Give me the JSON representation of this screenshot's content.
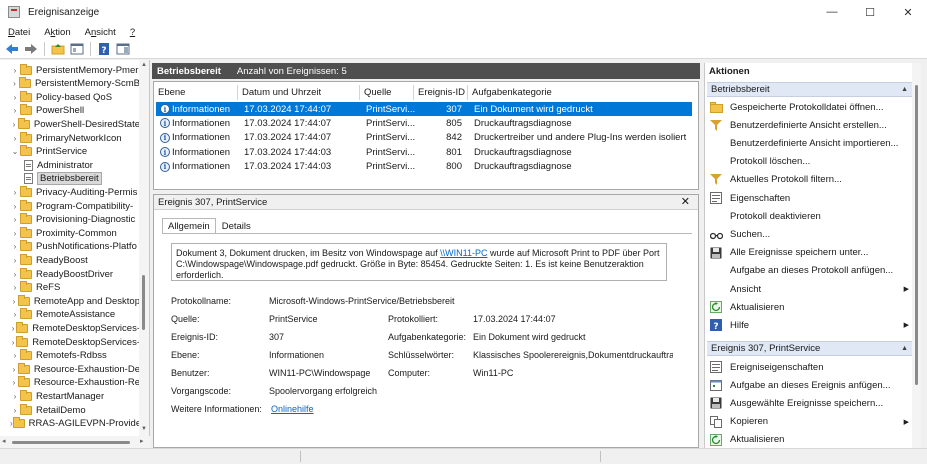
{
  "window": {
    "title": "Ereignisanzeige",
    "controls": [
      "—",
      "☐",
      "✕"
    ]
  },
  "menu": [
    {
      "label": "Datei",
      "accel": "D",
      "rest": "atei"
    },
    {
      "label": "Aktion",
      "accel": "k",
      "pre": "A",
      "rest": "tion"
    },
    {
      "label": "Ansicht",
      "accel": "n",
      "pre": "A",
      "rest": "sicht"
    },
    {
      "label": "?",
      "accel": "?",
      "rest": ""
    }
  ],
  "toolbar": [
    "back-arrow-icon",
    "forward-arrow-icon",
    "folder-up-icon",
    "console-tree-icon",
    "help-icon",
    "action-pane-icon"
  ],
  "tree": {
    "items": [
      {
        "label": "PersistentMemory-Pmer",
        "level": 1,
        "type": "folder",
        "expander": "›"
      },
      {
        "label": "PersistentMemory-ScmB",
        "level": 1,
        "type": "folder",
        "expander": "›"
      },
      {
        "label": "Policy-based QoS",
        "level": 1,
        "type": "folder",
        "expander": "›"
      },
      {
        "label": "PowerShell",
        "level": 1,
        "type": "folder",
        "expander": "›"
      },
      {
        "label": "PowerShell-DesiredState",
        "level": 1,
        "type": "folder",
        "expander": "›"
      },
      {
        "label": "PrimaryNetworkIcon",
        "level": 1,
        "type": "folder",
        "expander": "›"
      },
      {
        "label": "PrintService",
        "level": 1,
        "type": "folder",
        "expander": "⌄"
      },
      {
        "label": "Administrator",
        "level": 2,
        "type": "doc",
        "expander": ""
      },
      {
        "label": "Betriebsbereit",
        "level": 2,
        "type": "doc",
        "expander": "",
        "selected": true
      },
      {
        "label": "Privacy-Auditing-Permis",
        "level": 1,
        "type": "folder",
        "expander": "›"
      },
      {
        "label": "Program-Compatibility-",
        "level": 1,
        "type": "folder",
        "expander": "›"
      },
      {
        "label": "Provisioning-Diagnostic",
        "level": 1,
        "type": "folder",
        "expander": "›"
      },
      {
        "label": "Proximity-Common",
        "level": 1,
        "type": "folder",
        "expander": "›"
      },
      {
        "label": "PushNotifications-Platfo",
        "level": 1,
        "type": "folder",
        "expander": "›"
      },
      {
        "label": "ReadyBoost",
        "level": 1,
        "type": "folder",
        "expander": "›"
      },
      {
        "label": "ReadyBoostDriver",
        "level": 1,
        "type": "folder",
        "expander": "›"
      },
      {
        "label": "ReFS",
        "level": 1,
        "type": "folder",
        "expander": "›"
      },
      {
        "label": "RemoteApp and Desktop",
        "level": 1,
        "type": "folder",
        "expander": "›"
      },
      {
        "label": "RemoteAssistance",
        "level": 1,
        "type": "folder",
        "expander": "›"
      },
      {
        "label": "RemoteDesktopServices-",
        "level": 1,
        "type": "folder",
        "expander": "›"
      },
      {
        "label": "RemoteDesktopServices-",
        "level": 1,
        "type": "folder",
        "expander": "›"
      },
      {
        "label": "Remotefs-Rdbss",
        "level": 1,
        "type": "folder",
        "expander": "›"
      },
      {
        "label": "Resource-Exhaustion-De",
        "level": 1,
        "type": "folder",
        "expander": "›"
      },
      {
        "label": "Resource-Exhaustion-Re",
        "level": 1,
        "type": "folder",
        "expander": "›"
      },
      {
        "label": "RestartManager",
        "level": 1,
        "type": "folder",
        "expander": "›"
      },
      {
        "label": "RetailDemo",
        "level": 1,
        "type": "folder",
        "expander": "›"
      },
      {
        "label": "RRAS-AGILEVPN-Provide",
        "level": 1,
        "type": "folder",
        "expander": "›"
      }
    ]
  },
  "center": {
    "log_name": "Betriebsbereit",
    "count_text": "Anzahl von Ereignissen: 5",
    "columns": [
      "Ebene",
      "Datum und Uhrzeit",
      "Quelle",
      "Ereignis-ID",
      "Aufgabenkategorie"
    ],
    "rows": [
      {
        "level": "Informationen",
        "date": "17.03.2024 17:44:07",
        "source": "PrintServi...",
        "id": "307",
        "category": "Ein Dokument wird gedruckt",
        "selected": true
      },
      {
        "level": "Informationen",
        "date": "17.03.2024 17:44:07",
        "source": "PrintServi...",
        "id": "805",
        "category": "Druckauftragsdiagnose"
      },
      {
        "level": "Informationen",
        "date": "17.03.2024 17:44:07",
        "source": "PrintServi...",
        "id": "842",
        "category": "Druckertreiber und andere Plug-Ins werden isoliert"
      },
      {
        "level": "Informationen",
        "date": "17.03.2024 17:44:03",
        "source": "PrintServi...",
        "id": "801",
        "category": "Druckauftragsdiagnose"
      },
      {
        "level": "Informationen",
        "date": "17.03.2024 17:44:03",
        "source": "PrintServi...",
        "id": "800",
        "category": "Druckauftragsdiagnose"
      }
    ]
  },
  "detail": {
    "title": "Ereignis 307, PrintService",
    "close": "✕",
    "tabs": [
      "Allgemein",
      "Details"
    ],
    "description": {
      "pre": "Dokument 3, Dokument drucken, im Besitz von Windowspage auf ",
      "link": "\\\\WIN11-PC",
      "post": " wurde auf Microsoft Print to PDF über Port C:\\Windowspage\\Windowspage.pdf gedruckt. Größe in Byte: 85454. Gedruckte Seiten: 1. Es ist keine Benutzeraktion erforderlich."
    },
    "fields": {
      "protokollname_label": "Protokollname:",
      "protokollname": "Microsoft-Windows-PrintService/Betriebsbereit",
      "quelle_label": "Quelle:",
      "quelle": "PrintService",
      "protokolliert_label": "Protokolliert:",
      "protokolliert": "17.03.2024 17:44:07",
      "id_label": "Ereignis-ID:",
      "id": "307",
      "kategorie_label": "Aufgabenkategorie:",
      "kategorie": "Ein Dokument wird gedruckt",
      "ebene_label": "Ebene:",
      "ebene": "Informationen",
      "schluessel_label": "Schlüsselwörter:",
      "schluessel": "Klassisches Spoolerereignis,Dokumentdruckauftrag",
      "benutzer_label": "Benutzer:",
      "benutzer": "WIN11-PC\\Windowspage",
      "computer_label": "Computer:",
      "computer": "Win11-PC",
      "vorgang_label": "Vorgangscode:",
      "vorgang": "Spoolervorgang erfolgreich",
      "weitere_label": "Weitere Informationen:",
      "weitere_link": "Onlinehilfe"
    }
  },
  "actions": {
    "title": "Aktionen",
    "section1": "Betriebsbereit",
    "section1_items": [
      {
        "label": "Gespeicherte Protokolldatei öffnen...",
        "icon": "open-folder-icon"
      },
      {
        "label": "Benutzerdefinierte Ansicht erstellen...",
        "icon": "filter-icon"
      },
      {
        "label": "Benutzerdefinierte Ansicht importieren...",
        "icon": ""
      },
      {
        "label": "Protokoll löschen...",
        "icon": ""
      },
      {
        "label": "Aktuelles Protokoll filtern...",
        "icon": "filter-icon"
      },
      {
        "label": "Eigenschaften",
        "icon": "properties-icon"
      },
      {
        "label": "Protokoll deaktivieren",
        "icon": ""
      },
      {
        "label": "Suchen...",
        "icon": "find-icon"
      },
      {
        "label": "Alle Ereignisse speichern unter...",
        "icon": "save-icon"
      },
      {
        "label": "Aufgabe an dieses Protokoll anfügen...",
        "icon": ""
      },
      {
        "label": "Ansicht",
        "icon": "",
        "submenu": true
      },
      {
        "label": "Aktualisieren",
        "icon": "refresh-icon"
      },
      {
        "label": "Hilfe",
        "icon": "help-icon",
        "submenu": true
      }
    ],
    "section2": "Ereignis 307, PrintService",
    "section2_items": [
      {
        "label": "Ereigniseigenschaften",
        "icon": "event-properties-icon"
      },
      {
        "label": "Aufgabe an dieses Ereignis anfügen...",
        "icon": "task-icon"
      },
      {
        "label": "Ausgewählte Ereignisse speichern...",
        "icon": "save-icon"
      },
      {
        "label": "Kopieren",
        "icon": "copy-icon",
        "submenu": true
      },
      {
        "label": "Aktualisieren",
        "icon": "refresh-icon"
      }
    ]
  }
}
